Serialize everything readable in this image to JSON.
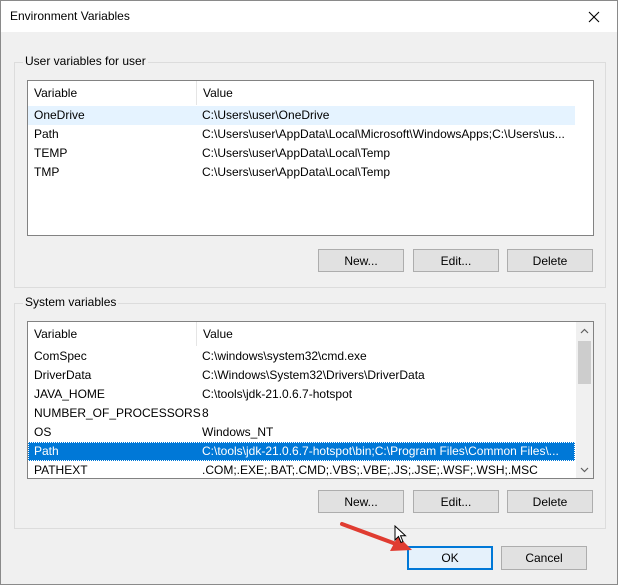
{
  "window": {
    "title": "Environment Variables",
    "close_icon": "close-icon"
  },
  "user_vars": {
    "group_label": "User variables for user",
    "columns": [
      "Variable",
      "Value"
    ],
    "rows": [
      {
        "variable": "OneDrive",
        "value": "C:\\Users\\user\\OneDrive"
      },
      {
        "variable": "Path",
        "value": "C:\\Users\\user\\AppData\\Local\\Microsoft\\WindowsApps;C:\\Users\\us..."
      },
      {
        "variable": "TEMP",
        "value": "C:\\Users\\user\\AppData\\Local\\Temp"
      },
      {
        "variable": "TMP",
        "value": "C:\\Users\\user\\AppData\\Local\\Temp"
      }
    ],
    "buttons": {
      "new": "New...",
      "edit": "Edit...",
      "delete": "Delete"
    }
  },
  "system_vars": {
    "group_label": "System variables",
    "columns": [
      "Variable",
      "Value"
    ],
    "rows": [
      {
        "variable": "ComSpec",
        "value": "C:\\windows\\system32\\cmd.exe"
      },
      {
        "variable": "DriverData",
        "value": "C:\\Windows\\System32\\Drivers\\DriverData"
      },
      {
        "variable": "JAVA_HOME",
        "value": "C:\\tools\\jdk-21.0.6.7-hotspot"
      },
      {
        "variable": "NUMBER_OF_PROCESSORS",
        "value": "8"
      },
      {
        "variable": "OS",
        "value": "Windows_NT"
      },
      {
        "variable": "Path",
        "value": "C:\\tools\\jdk-21.0.6.7-hotspot\\bin;C:\\Program Files\\Common Files\\..."
      },
      {
        "variable": "PATHEXT",
        "value": ".COM;.EXE;.BAT;.CMD;.VBS;.VBE;.JS;.JSE;.WSF;.WSH;.MSC"
      }
    ],
    "selected_row": "Path",
    "buttons": {
      "new": "New...",
      "edit": "Edit...",
      "delete": "Delete"
    }
  },
  "footer": {
    "ok": "OK",
    "cancel": "Cancel"
  },
  "colors": {
    "selection": "#0078d7",
    "hover": "#e5f3ff",
    "annotation_arrow": "#e03c31"
  },
  "icons": [
    "close-icon",
    "scroll-up-icon",
    "scroll-down-icon",
    "mouse-cursor-icon",
    "annotation-arrow-icon"
  ]
}
